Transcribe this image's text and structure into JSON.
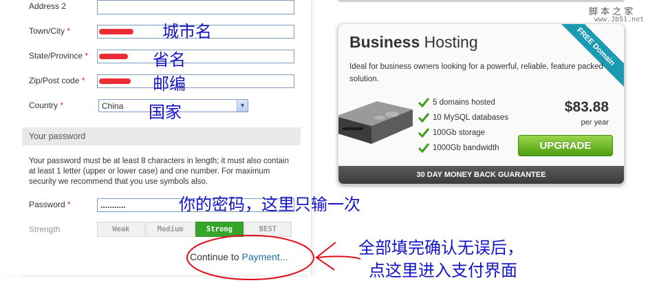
{
  "form": {
    "address2_label": "Address 2",
    "city_label": "Town/City",
    "state_label": "State/Province",
    "zip_label": "Zip/Post code",
    "country_label": "Country",
    "country_value": "China",
    "required_mark": "*",
    "password_section_title": "Your password",
    "password_help": "Your password must be at least 8 characters in length; it must also contain at least 1 letter (upper or lower case) and one number. For maximum security we recommend that you use symbols also.",
    "password_label": "Password",
    "password_value": "...........",
    "strength_label": "Strength",
    "strength_levels": [
      "Weak",
      "Medium",
      "Strong",
      "BEST"
    ],
    "strength_active": "Strong",
    "continue_prefix": "Continue to",
    "continue_link": "Payment..."
  },
  "annotations": {
    "city": "城市名",
    "state": "省名",
    "zip": "邮编",
    "country": "国家",
    "password": "你的密码，这里只输一次",
    "continue_line1": "全部填完确认无误后，",
    "continue_line2": "点这里进入支付界面"
  },
  "card": {
    "title_bold": "Business",
    "title_rest": "Hosting",
    "ribbon": "FREE Domain",
    "description": "Ideal for business owners looking for a powerful, reliable, feature packed solution.",
    "features": [
      "5 domains hosted",
      "10 MySQL databases",
      "100Gb storage",
      "1000Gb bandwidth"
    ],
    "price": "$83.88",
    "per": "per year",
    "upgrade_label": "UPGRADE",
    "guarantee": "30 DAY MONEY BACK GUARANTEE"
  },
  "watermark": {
    "line1": "脚 本 之 家",
    "line2": "www.Jb51.net"
  },
  "colors": {
    "required": "#d8262b",
    "annotation": "#1515c8",
    "circle": "#e0101a",
    "strong": "#36a62b",
    "link": "#1a6fa8",
    "upgrade": "#5aab1a",
    "ribbon": "#1d9ab3"
  }
}
